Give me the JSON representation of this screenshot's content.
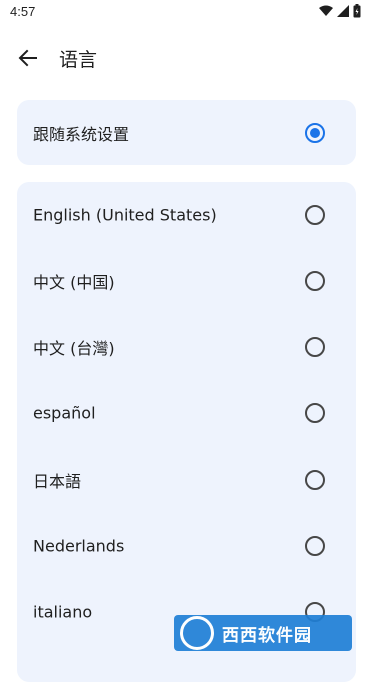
{
  "status_bar": {
    "time": "4:57",
    "icons": [
      "wifi-icon",
      "signal-icon",
      "battery-icon"
    ]
  },
  "app_bar": {
    "title": "语言",
    "back_icon": "arrow-back-icon"
  },
  "system_option": {
    "label": "跟随系统设置",
    "selected": true
  },
  "languages": [
    {
      "label": "English (United States)",
      "selected": false
    },
    {
      "label": "中文 (中国)",
      "selected": false
    },
    {
      "label": "中文 (台灣)",
      "selected": false
    },
    {
      "label": "español",
      "selected": false
    },
    {
      "label": "日本語",
      "selected": false
    },
    {
      "label": "Nederlands",
      "selected": false
    },
    {
      "label": "italiano",
      "selected": false
    }
  ],
  "watermark": {
    "text": "西西软件园"
  },
  "colors": {
    "card_bg": "#eef3fd",
    "accent": "#1a73e8",
    "text": "#1f1f1f"
  }
}
